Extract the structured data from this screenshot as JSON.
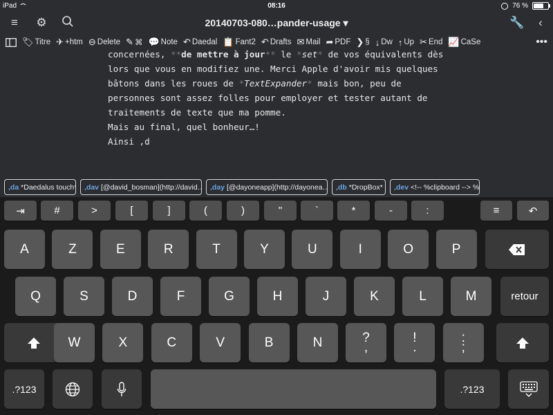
{
  "status": {
    "device": "iPad",
    "time": "08:16",
    "battery": "76 %",
    "battery_level": 0.76
  },
  "nav": {
    "title": "20140703-080…pander-usage ▾"
  },
  "toolbar": {
    "items": [
      {
        "icon": "text-tag-icon",
        "glyph": "🏷",
        "label": "Titre"
      },
      {
        "icon": "pin-icon",
        "glyph": "✈",
        "label": "+htm"
      },
      {
        "icon": "delete-icon",
        "glyph": "⊖",
        "label": "Delete"
      },
      {
        "icon": "edit-icon",
        "glyph": "✎",
        "label": "⌘"
      },
      {
        "icon": "note-icon",
        "glyph": "💬",
        "label": "Note"
      },
      {
        "icon": "daedal-icon",
        "glyph": "↶",
        "label": "Daedal"
      },
      {
        "icon": "clipboard-icon",
        "glyph": "📋",
        "label": "Fant2"
      },
      {
        "icon": "drafts-icon",
        "glyph": "↶",
        "label": "Drafts"
      },
      {
        "icon": "mail-icon",
        "glyph": "✉",
        "label": "Mail"
      },
      {
        "icon": "pdf-icon",
        "glyph": "➦",
        "label": "PDF"
      },
      {
        "icon": "section-icon",
        "glyph": "❯",
        "label": "§"
      },
      {
        "icon": "down-icon",
        "glyph": "↓",
        "label": "Dw"
      },
      {
        "icon": "up-icon",
        "glyph": "↑",
        "label": "Up"
      },
      {
        "icon": "end-icon",
        "glyph": "✂",
        "label": "End"
      },
      {
        "icon": "case-icon",
        "glyph": "📈",
        "label": "CaSe"
      }
    ]
  },
  "editor": {
    "line1": {
      "a": "concernées, ",
      "b": "**",
      "c": "de mettre à jour",
      "d": "**",
      "e": " le ",
      "f": "*",
      "g": "set",
      "h": "*",
      " i": "",
      "i": " de vos équivalents dès"
    },
    "line2": "lors que vous en modifiez une. Merci Apple d'avoir mis quelques",
    "line3": {
      "a": "bâtons dans les roues de ",
      "b": "*",
      "c": "TextExpander",
      "d": "*",
      "e": " mais bon, peu de"
    },
    "line4": "personnes sont assez folles pour employer et tester autant de",
    "line5": "traitements de texte que ma pomme.",
    "line6": "",
    "line7": "Mais au final, quel bonheur…!",
    "line8": "",
    "line9": "Ainsi ,d"
  },
  "snippets": [
    {
      "abbr": ",da",
      "text": "*Daedalus touch*"
    },
    {
      "abbr": ",dav",
      "text": "[@david_bosman](http://david…"
    },
    {
      "abbr": ",day",
      "text": "[@dayoneapp](http://dayonea…"
    },
    {
      "abbr": ",db",
      "text": "*DropBox*"
    },
    {
      "abbr": ",dev",
      "text": "<!-- %clipboard --> %|"
    }
  ],
  "keyboard": {
    "extra_row": [
      "⇥",
      "#",
      ">",
      "[",
      "]",
      "(",
      ")",
      "\"",
      "`",
      "*",
      "-",
      ":",
      "≡",
      "↶"
    ],
    "row1": [
      "A",
      "Z",
      "E",
      "R",
      "T",
      "Y",
      "U",
      "I",
      "O",
      "P"
    ],
    "row2": [
      "Q",
      "S",
      "D",
      "F",
      "G",
      "H",
      "J",
      "K",
      "L",
      "M"
    ],
    "row3": [
      "W",
      "X",
      "C",
      "V",
      "B",
      "N"
    ],
    "row3_punct": [
      [
        "?",
        ","
      ],
      [
        "!",
        "."
      ],
      [
        ":",
        ";"
      ]
    ],
    "return_label": "retour",
    "numbers_label": ".?123"
  }
}
